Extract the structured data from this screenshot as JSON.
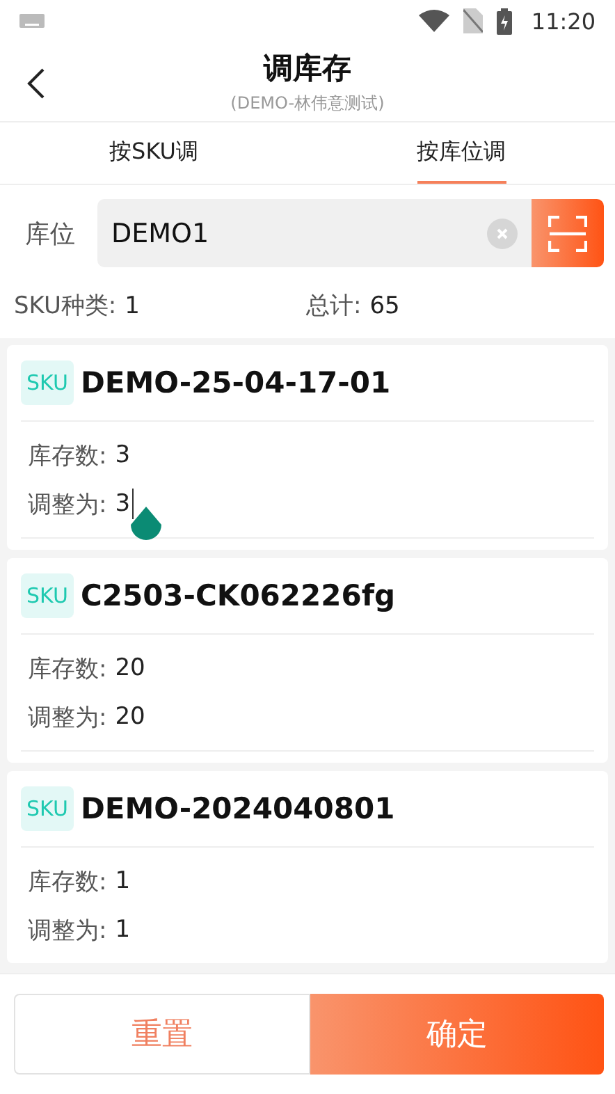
{
  "status_bar": {
    "time": "11:20"
  },
  "header": {
    "title": "调库存",
    "subtitle": "(DEMO-林伟意测试)"
  },
  "tabs": [
    {
      "label": "按SKU调",
      "selected": false
    },
    {
      "label": "按库位调",
      "selected": true
    }
  ],
  "location": {
    "label": "库位",
    "value": "DEMO1"
  },
  "summary": {
    "sku_label": "SKU种类:",
    "sku_value": "1",
    "total_label": "总计:",
    "total_value": "65"
  },
  "items": [
    {
      "tag": "SKU",
      "code": "DEMO-25-04-17-01",
      "stock_label": "库存数:",
      "stock": "3",
      "adjust_label": "调整为:",
      "adjust": "3",
      "focused": true
    },
    {
      "tag": "SKU",
      "code": "C2503-CK062226fg",
      "stock_label": "库存数:",
      "stock": "20",
      "adjust_label": "调整为:",
      "adjust": "20",
      "focused": false
    },
    {
      "tag": "SKU",
      "code": "DEMO-2024040801",
      "stock_label": "库存数:",
      "stock": "1",
      "adjust_label": "调整为:",
      "adjust": "1",
      "focused": false
    }
  ],
  "buttons": {
    "reset": "重置",
    "confirm": "确定"
  }
}
